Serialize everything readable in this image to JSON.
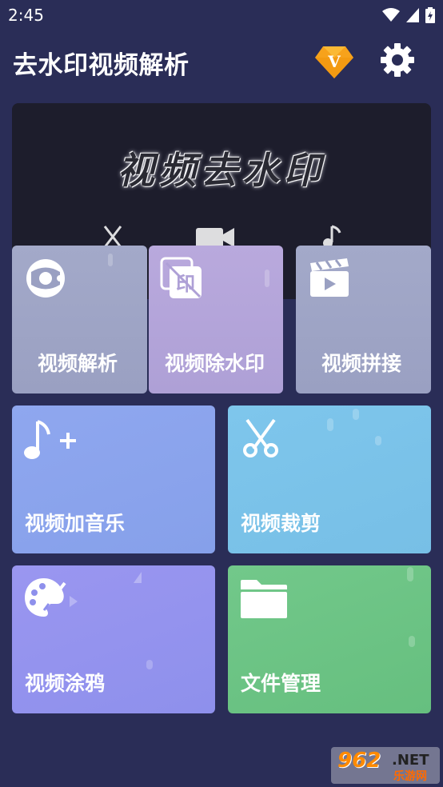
{
  "status_bar": {
    "time": "2:45"
  },
  "header": {
    "title": "去水印视频解析",
    "vip_badge_letter": "V",
    "vip_color": "#f7a21b"
  },
  "banner": {
    "title": "视频去水印"
  },
  "tiles": [
    {
      "label": "视频解析",
      "icon": "video-parse-icon"
    },
    {
      "label": "视频除水印",
      "icon": "remove-watermark-icon"
    },
    {
      "label": "视频拼接",
      "icon": "video-clip-icon"
    },
    {
      "label": "视频加音乐",
      "icon": "music-add-icon"
    },
    {
      "label": "视频裁剪",
      "icon": "scissors-icon"
    },
    {
      "label": "视频涂鸦",
      "icon": "palette-icon"
    },
    {
      "label": "文件管理",
      "icon": "folder-icon"
    }
  ],
  "watermark": {
    "num": "962",
    "net": ".NET",
    "cn": "乐游网"
  },
  "colors": {
    "background": "#2a2d57",
    "accent": "#f7a21b"
  }
}
